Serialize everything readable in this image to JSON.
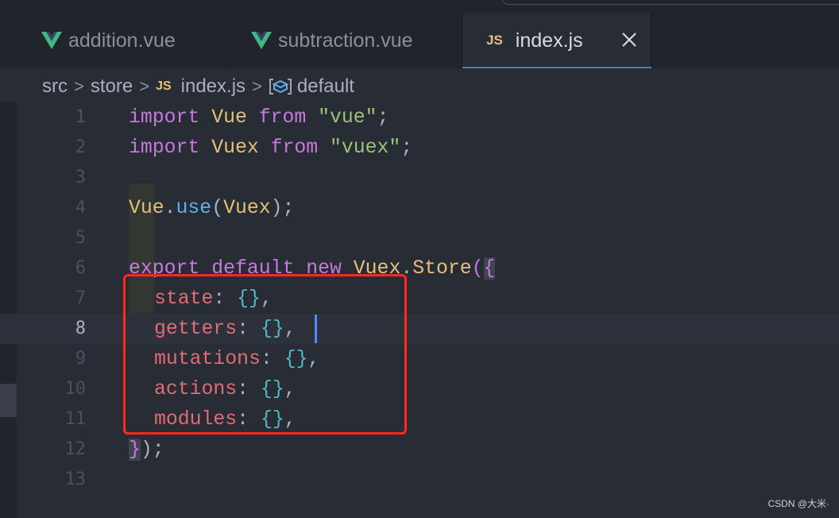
{
  "tabs": [
    {
      "label": "addition.vue",
      "icon": "vue-icon",
      "active": false
    },
    {
      "label": "subtraction.vue",
      "icon": "vue-icon",
      "active": false
    },
    {
      "label": "index.js",
      "icon": "js-icon",
      "active": true
    }
  ],
  "js_icon_text": "JS",
  "breadcrumb": {
    "items": [
      "src",
      "store",
      "index.js",
      "default"
    ],
    "separator": ">"
  },
  "code_lines": [
    {
      "num": "1"
    },
    {
      "num": "2"
    },
    {
      "num": "3"
    },
    {
      "num": "4"
    },
    {
      "num": "5"
    },
    {
      "num": "6"
    },
    {
      "num": "7"
    },
    {
      "num": "8"
    },
    {
      "num": "9"
    },
    {
      "num": "10"
    },
    {
      "num": "11"
    },
    {
      "num": "12"
    },
    {
      "num": "13"
    }
  ],
  "code": {
    "l1": {
      "kw": "import",
      "id": "Vue",
      "from": "from",
      "str": "\"vue\"",
      "end": ";"
    },
    "l2": {
      "kw": "import",
      "id": "Vuex",
      "from": "from",
      "str": "\"vuex\"",
      "end": ";"
    },
    "l4": {
      "obj": "Vue",
      "dot": ".",
      "fn": "use",
      "open": "(",
      "arg": "Vuex",
      "close": ");"
    },
    "l6": {
      "export": "export",
      "default": "default",
      "new": "new",
      "cls": "Vuex",
      "dot": ".",
      "store": "Store",
      "paren": "(",
      "brace": "{"
    },
    "props": [
      {
        "name": "state",
        "colon": ": ",
        "val": "{}",
        "comma": ","
      },
      {
        "name": "getters",
        "colon": ": ",
        "val": "{}",
        "comma": ","
      },
      {
        "name": "mutations",
        "colon": ": ",
        "val": "{}",
        "comma": ","
      },
      {
        "name": "actions",
        "colon": ": ",
        "val": "{}",
        "comma": ","
      },
      {
        "name": "modules",
        "colon": ": ",
        "val": "{}",
        "comma": ","
      }
    ],
    "l12": {
      "brace": "}",
      "rest": ");"
    }
  },
  "current_line": 8,
  "watermark": "CSDN @大米·",
  "colors": {
    "keyword": "#c678dd",
    "identifier": "#e5c07b",
    "string": "#98c379",
    "property": "#e06c75",
    "highlight_box": "#ff2a1f",
    "cursor": "#528bff"
  }
}
